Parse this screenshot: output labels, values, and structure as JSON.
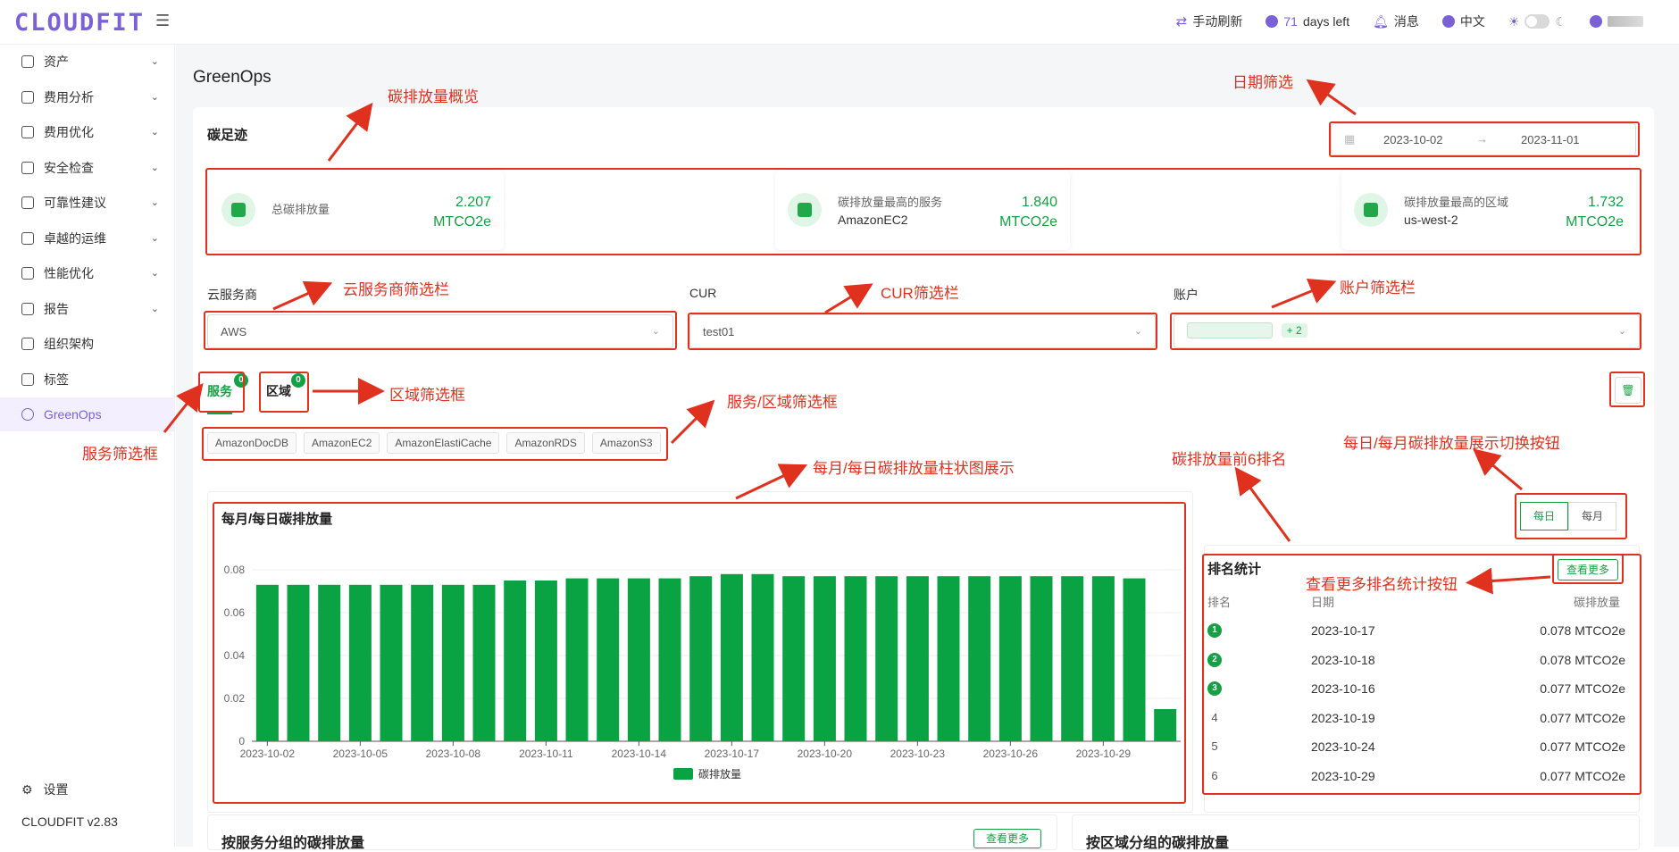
{
  "app": {
    "logo": "CLOUDFIT",
    "version": "CLOUDFIT v2.83",
    "page_title": "GreenOps"
  },
  "topbar": {
    "refresh_label": "手动刷新",
    "days_number": "71",
    "days_suffix": "days left",
    "messages_label": "消息",
    "language_label": "中文"
  },
  "sidebar": {
    "items": [
      {
        "label": "资产",
        "icon": "asset-icon"
      },
      {
        "label": "费用分析",
        "icon": "gauge-icon"
      },
      {
        "label": "费用优化",
        "icon": "dollar-icon"
      },
      {
        "label": "安全检查",
        "icon": "alarm-icon"
      },
      {
        "label": "可靠性建议",
        "icon": "checklist-icon"
      },
      {
        "label": "卓越的运维",
        "icon": "cloud-icon"
      },
      {
        "label": "性能优化",
        "icon": "chart-icon"
      },
      {
        "label": "报告",
        "icon": "report-icon"
      },
      {
        "label": "组织架构",
        "icon": "org-icon"
      },
      {
        "label": "标签",
        "icon": "tag-icon"
      },
      {
        "label": "GreenOps",
        "icon": "leaf-icon"
      }
    ],
    "settings_label": "设置"
  },
  "footprint": {
    "title": "碳足迹",
    "date_start": "2023-10-02",
    "date_end": "2023-11-01",
    "date_sep": "→",
    "total_label": "总碳排放量",
    "total_value": "2.207",
    "total_unit": "MTCO2e",
    "top_service_label": "碳排放量最高的服务",
    "top_service_name": "AmazonEC2",
    "top_service_value": "1.840",
    "top_service_unit": "MTCO2e",
    "top_region_label": "碳排放量最高的区域",
    "top_region_name": "us-west-2",
    "top_region_value": "1.732",
    "top_region_unit": "MTCO2e"
  },
  "filters": {
    "provider_label": "云服务商",
    "provider_value": "AWS",
    "cur_label": "CUR",
    "cur_value": "test01",
    "account_label": "账户",
    "account_more": "+ 2"
  },
  "tabs": {
    "service_label": "服务",
    "service_count": "0",
    "region_label": "区域",
    "region_count": "0"
  },
  "services": [
    "AmazonDocDB",
    "AmazonEC2",
    "AmazonElastiCache",
    "AmazonRDS",
    "AmazonS3"
  ],
  "chart_section": {
    "title": "每月/每日碳排放量",
    "toggle_daily": "每日",
    "toggle_monthly": "每月"
  },
  "chart_data": {
    "type": "bar",
    "title": "每月/每日碳排放量",
    "x": [
      "2023-10-02",
      "2023-10-03",
      "2023-10-04",
      "2023-10-05",
      "2023-10-06",
      "2023-10-07",
      "2023-10-08",
      "2023-10-09",
      "2023-10-10",
      "2023-10-11",
      "2023-10-12",
      "2023-10-13",
      "2023-10-14",
      "2023-10-15",
      "2023-10-16",
      "2023-10-17",
      "2023-10-18",
      "2023-10-19",
      "2023-10-20",
      "2023-10-21",
      "2023-10-22",
      "2023-10-23",
      "2023-10-24",
      "2023-10-25",
      "2023-10-26",
      "2023-10-27",
      "2023-10-28",
      "2023-10-29",
      "2023-10-30",
      "2023-10-31"
    ],
    "x_tick_labels": [
      "2023-10-02",
      "2023-10-05",
      "2023-10-08",
      "2023-10-11",
      "2023-10-14",
      "2023-10-17",
      "2023-10-20",
      "2023-10-23",
      "2023-10-26",
      "2023-10-29"
    ],
    "series": [
      {
        "name": "碳排放量",
        "color": "#0aa343",
        "values": [
          0.073,
          0.073,
          0.073,
          0.073,
          0.073,
          0.073,
          0.073,
          0.073,
          0.075,
          0.075,
          0.076,
          0.076,
          0.076,
          0.076,
          0.077,
          0.078,
          0.078,
          0.077,
          0.077,
          0.077,
          0.077,
          0.077,
          0.077,
          0.077,
          0.077,
          0.077,
          0.077,
          0.077,
          0.076,
          0.015
        ]
      }
    ],
    "ylim": [
      0,
      0.08
    ],
    "yticks": [
      "0",
      "0.02",
      "0.04",
      "0.06",
      "0.08"
    ],
    "legend": "bottom"
  },
  "ranking": {
    "title": "排名统计",
    "more_label": "查看更多",
    "col_rank": "排名",
    "col_date": "日期",
    "col_value": "碳排放量",
    "rows": [
      {
        "rank": "1",
        "date": "2023-10-17",
        "value": "0.078 MTCO2e"
      },
      {
        "rank": "2",
        "date": "2023-10-18",
        "value": "0.078 MTCO2e"
      },
      {
        "rank": "3",
        "date": "2023-10-16",
        "value": "0.077 MTCO2e"
      },
      {
        "rank": "4",
        "date": "2023-10-19",
        "value": "0.077 MTCO2e"
      },
      {
        "rank": "5",
        "date": "2023-10-24",
        "value": "0.077 MTCO2e"
      },
      {
        "rank": "6",
        "date": "2023-10-29",
        "value": "0.077 MTCO2e"
      }
    ]
  },
  "bottom": {
    "by_service_title": "按服务分组的碳排放量",
    "by_service_more": "查看更多",
    "by_region_title": "按区域分组的碳排放量"
  },
  "annotations": {
    "overview": "碳排放量概览",
    "date_filter": "日期筛选",
    "provider_filter": "云服务商筛选栏",
    "cur_filter": "CUR筛选栏",
    "account_filter": "账户筛选栏",
    "region_filter": "区域筛选框",
    "service_region_filter": "服务/区域筛选框",
    "service_filter": "服务筛选框",
    "bar_chart": "每月/每日碳排放量柱状图展示",
    "top6": "碳排放量前6排名",
    "toggle_desc": "每日/每月碳排放量展示切换按钮",
    "more_desc": "查看更多排名统计按钮"
  }
}
